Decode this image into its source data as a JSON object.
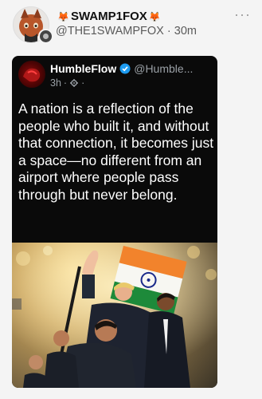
{
  "tweet": {
    "author_name": "SWAMP1FOX",
    "handle": "@THE1SWAMPFOX",
    "separator": "·",
    "time": "30m",
    "more_icon": "more-dots-icon"
  },
  "embed": {
    "name": "HumbleFlow",
    "handle": "@Humble...",
    "time": "3h",
    "dot": "·",
    "text": "A nation is a reflection of the people who built it, and without that connection, it becomes just a space—no different from an airport where people pass through but never belong.",
    "colors": {
      "background": "#0a0a0a",
      "verified": "#1d9bf0"
    }
  }
}
